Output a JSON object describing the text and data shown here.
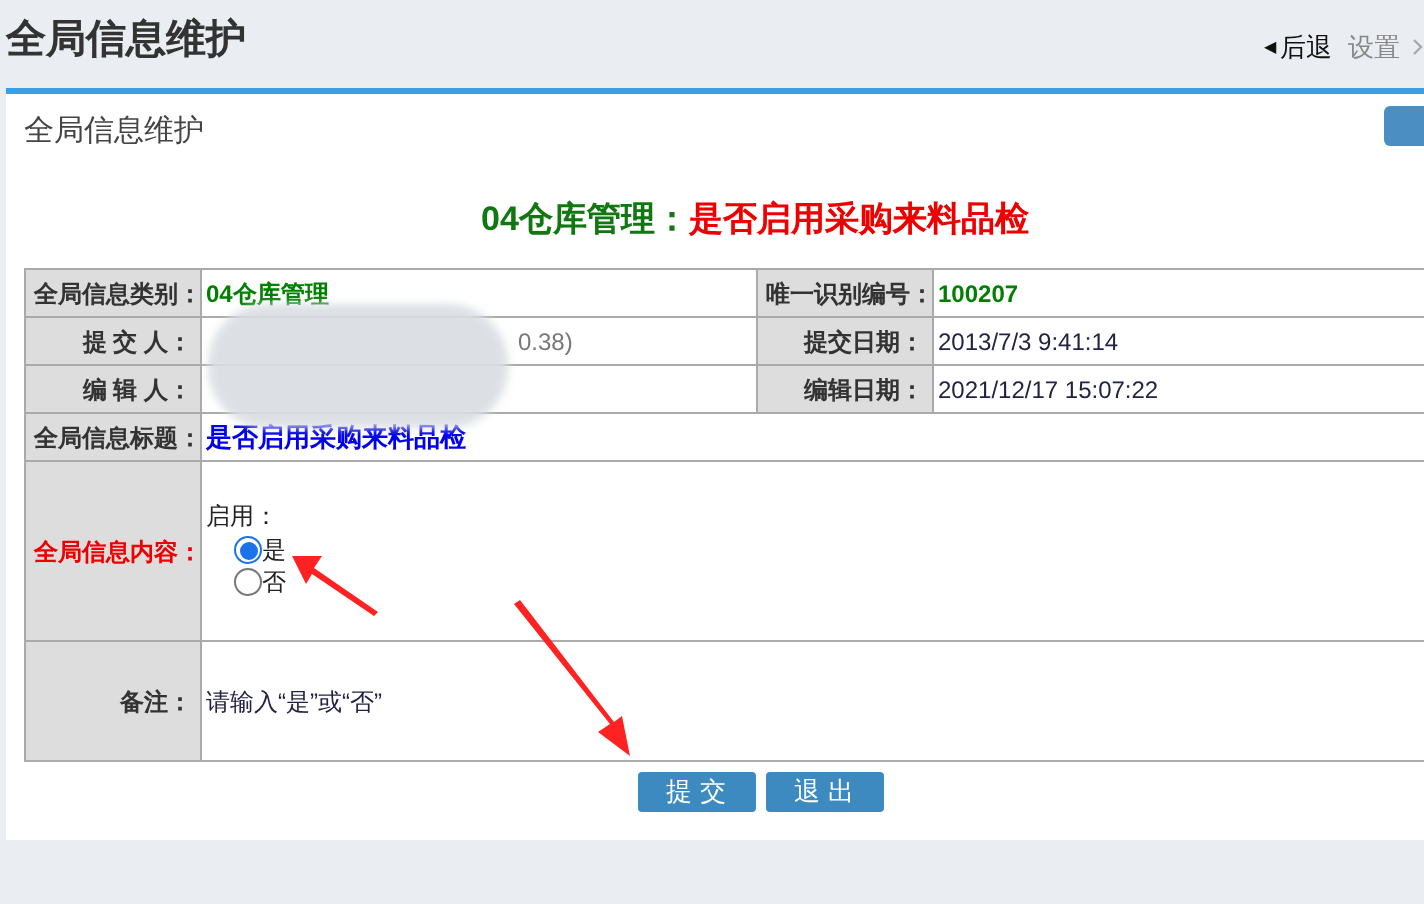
{
  "header": {
    "title": "全局信息维护",
    "breadcrumb": [
      {
        "icon": "◀",
        "label": "后退",
        "kind": "back"
      },
      {
        "label": "设置",
        "kind": "link"
      }
    ]
  },
  "panel": {
    "title": "全局信息维护"
  },
  "heading": {
    "category": "04仓库管理：",
    "title": "是否启用采购来料品检"
  },
  "info_rows": [
    {
      "label": "全局信息类别：",
      "value": "04仓库管理",
      "highlight": true,
      "label2": "唯一识别编号：",
      "value2": "100207",
      "highlight2": true
    },
    {
      "label": "提 交 人：",
      "value": "0.38)",
      "highlight": false,
      "label2": "提交日期：",
      "value2": "2013/7/3 9:41:14",
      "highlight2": false
    },
    {
      "label": "编 辑 人：",
      "label2": "编辑日期：",
      "value2": "2021/12/17 15:07:22",
      "highlight2": false
    }
  ],
  "title_row": {
    "label": "全局信息标题：",
    "value": "是否启用采购来料品检"
  },
  "content_row": {
    "label": "全局信息内容：",
    "prompt": "启用：",
    "options": [
      {
        "label": "是",
        "selected": true
      },
      {
        "label": "否",
        "selected": false
      }
    ]
  },
  "remark_row": {
    "label": "备注：",
    "value": "请输入“是”或“否”"
  },
  "buttons": [
    "提 交",
    "退 出"
  ]
}
